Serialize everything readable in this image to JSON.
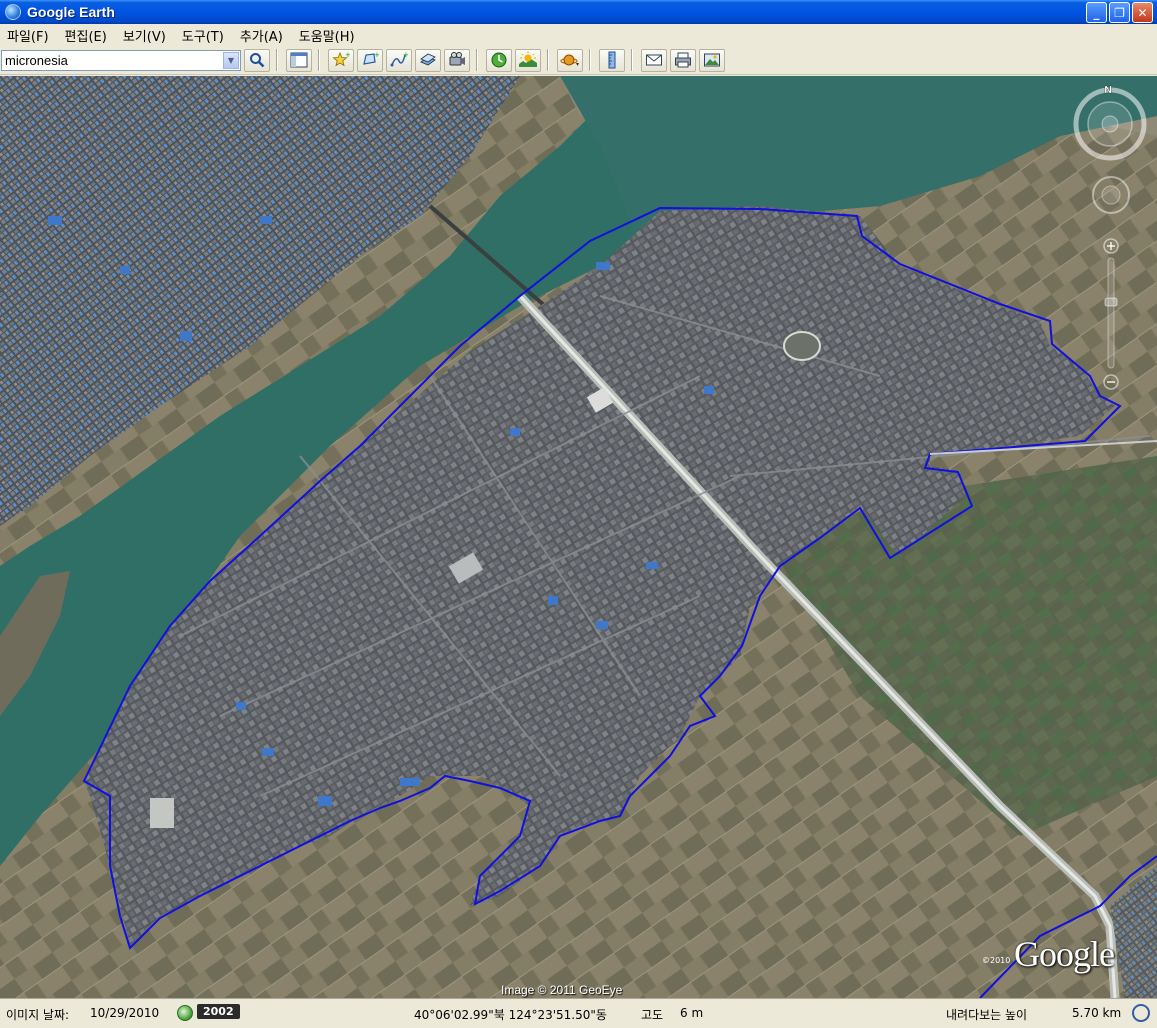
{
  "window": {
    "title": "Google Earth",
    "controls": [
      "_",
      "❐",
      "✕"
    ]
  },
  "menu": [
    "파일(F)",
    "편집(E)",
    "보기(V)",
    "도구(T)",
    "추가(A)",
    "도움말(H)"
  ],
  "search": {
    "value": "micronesia"
  },
  "toolbar_icons": [
    "search-icon",
    "sidebar-toggle-icon",
    "add-placemark-icon",
    "add-polygon-icon",
    "add-path-icon",
    "image-overlay-icon",
    "record-tour-icon",
    "historical-imagery-icon",
    "sunlight-icon",
    "switch-planet-icon",
    "ruler-icon",
    "email-icon",
    "print-icon",
    "save-image-icon"
  ],
  "map": {
    "copyright": "Image © 2011 GeoEye",
    "logo": "Google",
    "logo_year": "©2010",
    "compass_north": "N",
    "boundary_color": "#1010e0",
    "river_color": "#2f6f66"
  },
  "status": {
    "imagery_date_label": "이미지 날짜:",
    "imagery_date": "10/29/2010",
    "year": "2002",
    "coordinates": "40°06'02.99\"북 124°23'51.50\"동",
    "elevation_label": "고도",
    "elevation": "6 m",
    "eye_alt_label": "내려다보는 높이",
    "eye_alt": "5.70 km"
  }
}
